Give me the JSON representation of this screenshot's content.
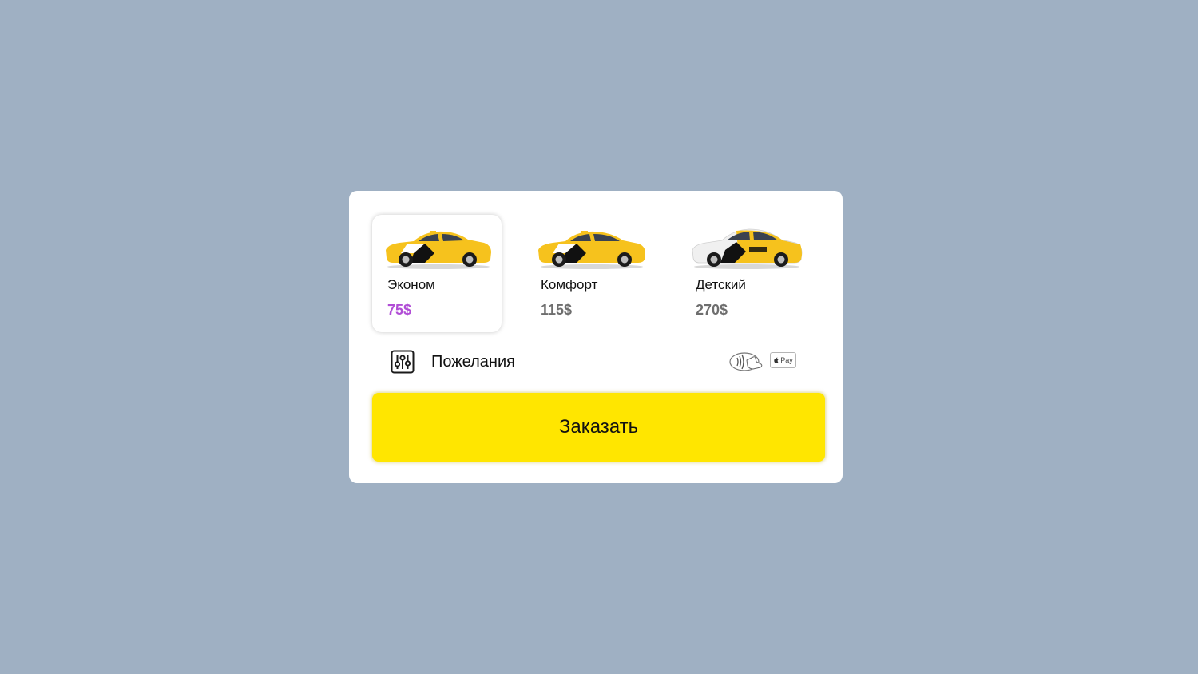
{
  "tariffs": [
    {
      "name": "Эконом",
      "price": "75$",
      "selected": true,
      "car_style": "yellow-sedan"
    },
    {
      "name": "Комфорт",
      "price": "115$",
      "selected": false,
      "car_style": "yellow-liftback"
    },
    {
      "name": "Детский",
      "price": "270$",
      "selected": false,
      "car_style": "white-yellow-sedan"
    }
  ],
  "wishes": {
    "label": "Пожелания",
    "icon": "sliders-icon"
  },
  "payment": {
    "contactless_icon": "contactless-payment-icon",
    "apple_pay_label": "Pay",
    "apple_icon": "apple-icon"
  },
  "order_button": {
    "label": "Заказать"
  },
  "colors": {
    "background": "#9fb0c3",
    "card": "#ffffff",
    "accent_yellow": "#ffe600",
    "selected_price": "#b14ed6",
    "price": "#6e6e6e"
  }
}
